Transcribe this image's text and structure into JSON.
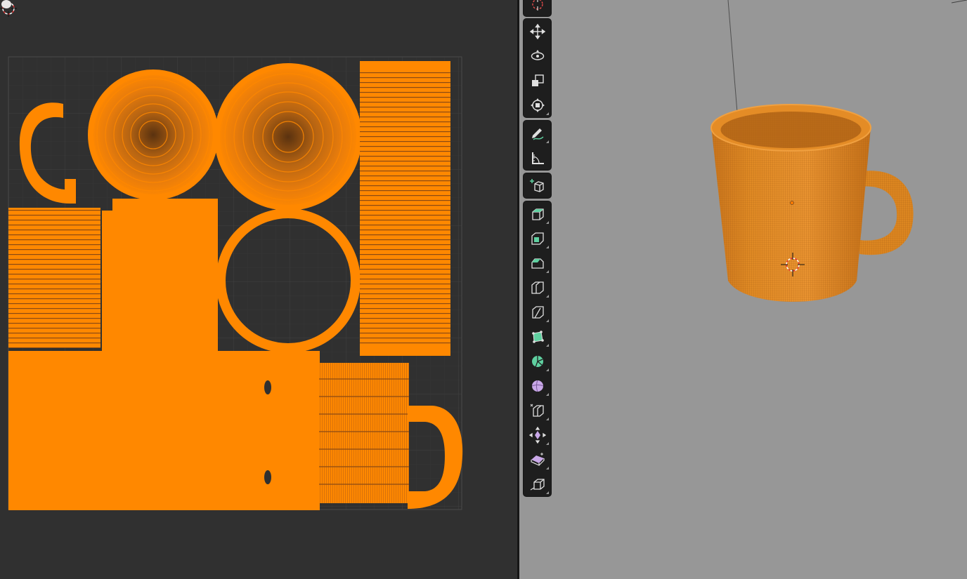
{
  "uv_editor": {
    "background_color": "#303030",
    "uv_color": "#ff8800",
    "grid_color": "#3a3a3a",
    "islands": [
      "handle-strip",
      "mug-bottom-disc",
      "mug-inner-bottom-disc",
      "rim-ring",
      "outer-wall-strip-top",
      "inner-wall-strip-left",
      "inner-wall-strip-right",
      "wall-block",
      "side-strip",
      "handle-loop"
    ]
  },
  "viewport": {
    "background_color": "#979797",
    "object": "mug",
    "object_color": "#e88a1c"
  },
  "toolbar": {
    "groups": [
      {
        "id": "top",
        "tools": [
          "cursor-icon"
        ]
      },
      {
        "id": "transform",
        "tools": [
          "move-icon",
          "rotate-icon",
          "scale-icon",
          "transform-icon"
        ]
      },
      {
        "id": "annotate",
        "tools": [
          "annotate-icon",
          "measure-icon"
        ]
      },
      {
        "id": "add",
        "tools": [
          "add-cube-icon"
        ]
      },
      {
        "id": "edit",
        "tools": [
          "extrude-region-icon",
          "inset-faces-icon",
          "bevel-icon",
          "loop-cut-icon",
          "knife-icon",
          "poly-build-icon",
          "spin-icon",
          "smooth-icon",
          "edge-slide-icon",
          "shrink-fatten-icon",
          "shear-icon",
          "rip-region-icon"
        ]
      }
    ]
  }
}
